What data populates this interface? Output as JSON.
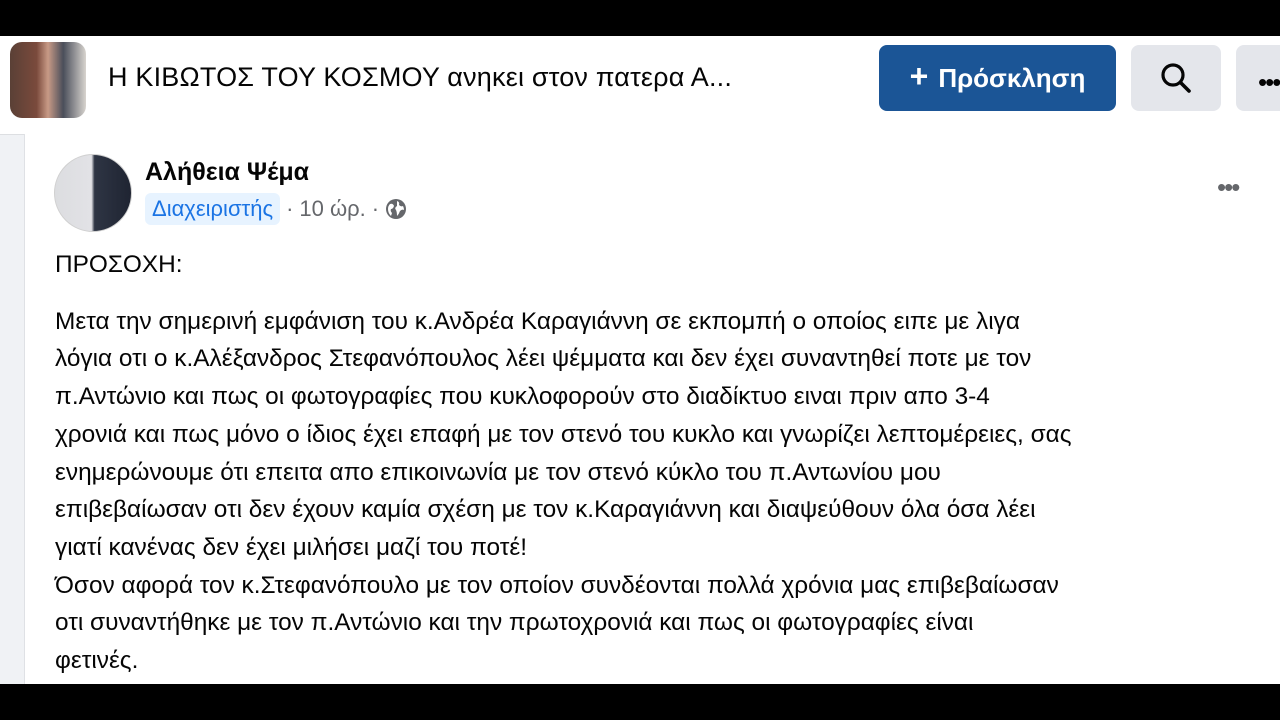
{
  "group": {
    "title": "Η ΚΙΒΩΤΟΣ ΤΟΥ ΚΟΣΜΟΥ ανηκει στον πατερα Α...",
    "invite_label": "Πρόσκληση",
    "invite_icon": "plus-icon",
    "search_icon": "search-icon",
    "more_icon": "more-horizontal-icon"
  },
  "post": {
    "author": "Αλήθεια Ψέμα",
    "role_badge": "Διαχειριστής",
    "time": "10 ώρ.",
    "separator": "·",
    "privacy_icon": "globe-icon",
    "menu_icon": "more-horizontal-icon",
    "heading": "ΠΡΟΣΟΧΗ:",
    "lines": [
      "Μετα την σημερινή εμφάνιση του κ.Ανδρέα Καραγιάννη σε εκπομπή ο οποίος ειπε με λιγα",
      "λόγια οτι ο κ.Αλέξανδρος Στεφανόπουλος λέει ψέμματα και δεν έχει συναντηθεί ποτε με τον",
      "π.Αντώνιο και πως οι φωτογραφίες που κυκλοφορούν στο διαδίκτυο ειναι πριν απο 3-4",
      "χρονιά και πως μόνο ο ίδιος έχει επαφή με τον στενό του κυκλο και γνωρίζει λεπτομέρειες, σας",
      "ενημερώνουμε ότι επειτα απο επικοινωνία με τον στενό κύκλο του π.Αντωνίου μου",
      "επιβεβαίωσαν οτι δεν έχουν καμία σχέση με τον κ.Καραγιάννη και διαψεύθουν όλα όσα λέει",
      "γιατί κανένας δεν έχει μιλήσει μαζί του ποτέ!",
      "Όσον αφορά τον κ.Στεφανόπουλο με τον οποίον συνδέονται πολλά χρόνια μας επιβεβαίωσαν",
      "οτι συναντήθηκε με τον π.Αντώνιο και την πρωτοχρονιά και πως οι φωτογραφίες είναι",
      "φετινές."
    ]
  },
  "colors": {
    "primary_button": "#1b5596",
    "badge_bg": "#e7f3ff",
    "badge_text": "#1b74e4",
    "secondary_text": "#65676b"
  }
}
